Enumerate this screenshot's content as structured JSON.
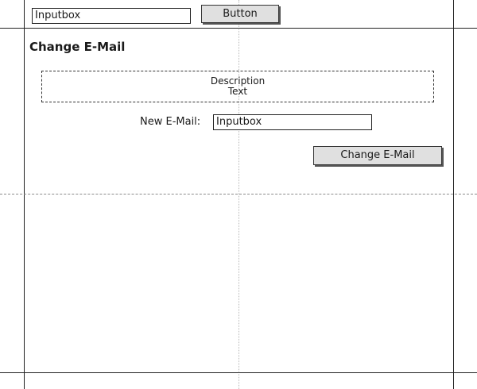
{
  "top_bar": {
    "inputbox_value": "Inputbox",
    "button_label": "Button"
  },
  "section": {
    "title": "Change E-Mail",
    "description_line1": "Description",
    "description_line2": "Text",
    "new_email_label": "New E-Mail:",
    "new_email_value": "Inputbox",
    "submit_label": "Change E-Mail"
  }
}
